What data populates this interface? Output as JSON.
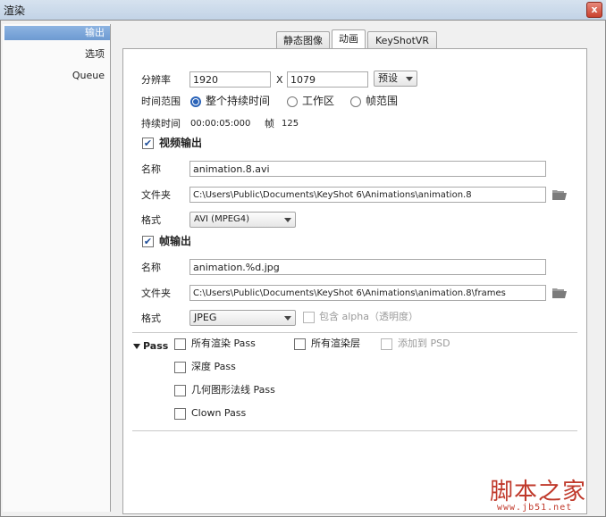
{
  "window": {
    "title": "渲染",
    "close_glyph": "x"
  },
  "sidebar": {
    "items": [
      {
        "label": "输出",
        "active": true
      },
      {
        "label": "选项"
      },
      {
        "label": "Queue"
      }
    ]
  },
  "tabs": [
    {
      "label": "静态图像"
    },
    {
      "label": "动画",
      "active": true
    },
    {
      "label": "KeyShotVR"
    }
  ],
  "resolution": {
    "label": "分辨率",
    "width": "1920",
    "x": "X",
    "height": "1079",
    "preset": "预设"
  },
  "time_range": {
    "label": "时间范围",
    "options": [
      "整个持续时间",
      "工作区",
      "帧范围"
    ],
    "selected": 0
  },
  "duration": {
    "label": "持续时间",
    "value": "00:00:05:000",
    "frames_label": "帧",
    "frames": "125"
  },
  "video_output": {
    "label": "视频输出",
    "checked": true,
    "name_label": "名称",
    "name": "animation.8.avi",
    "folder_label": "文件夹",
    "folder": "C:\\Users\\Public\\Documents\\KeyShot 6\\Animations\\animation.8",
    "format_label": "格式",
    "format": "AVI (MPEG4)"
  },
  "frame_output": {
    "label": "帧输出",
    "checked": true,
    "name_label": "名称",
    "name": "animation.%d.jpg",
    "folder_label": "文件夹",
    "folder": "C:\\Users\\Public\\Documents\\KeyShot 6\\Animations\\animation.8\\frames",
    "format_label": "格式",
    "format": "JPEG",
    "alpha_label": "包含 alpha（透明度）"
  },
  "pass": {
    "label": "Pass",
    "options": [
      "所有渲染 Pass",
      "所有渲染层",
      "添加到 PSD",
      "深度 Pass",
      "几何图形法线 Pass",
      "Clown Pass"
    ]
  },
  "watermark": {
    "text": "脚本之家",
    "url": "www.jb51.net"
  },
  "colors": {
    "accent": "#2a63b8",
    "sidebar_active": "#7aa5d8",
    "watermark": "#c0392b"
  }
}
